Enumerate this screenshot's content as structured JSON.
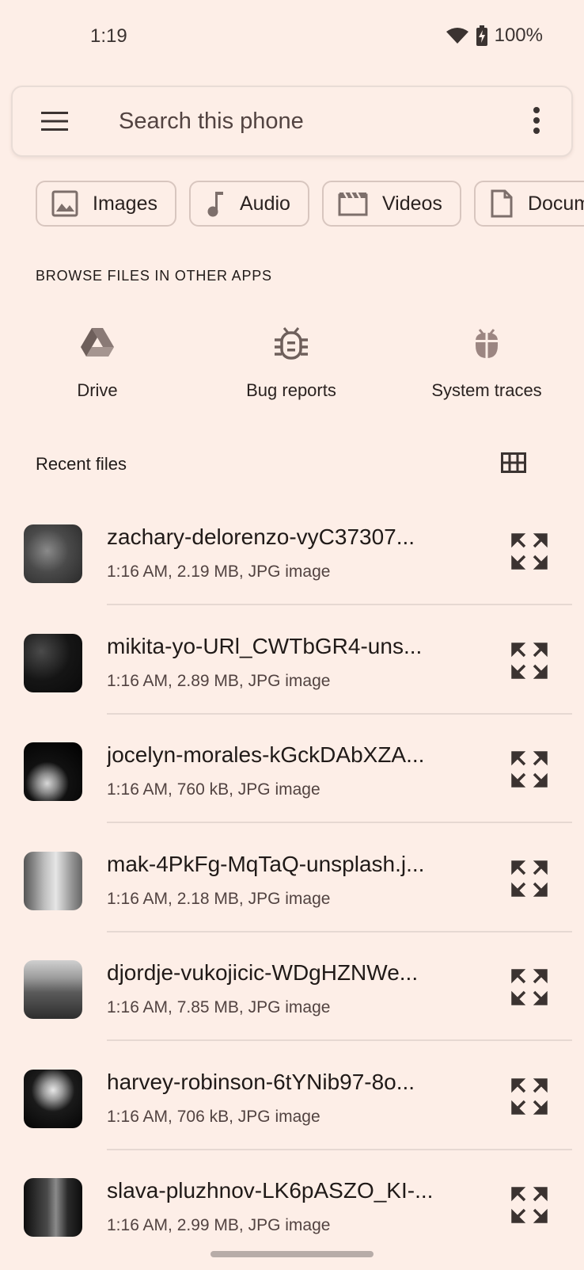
{
  "status_bar": {
    "time": "1:19",
    "battery": "100%",
    "icons": [
      "wifi-icon",
      "battery-charging-icon"
    ]
  },
  "search": {
    "placeholder": "Search this phone",
    "menu_icon": "menu-icon",
    "more_icon": "more-vert-icon"
  },
  "categories": [
    {
      "label": "Images",
      "icon": "image-icon"
    },
    {
      "label": "Audio",
      "icon": "music-note-icon"
    },
    {
      "label": "Videos",
      "icon": "movie-icon"
    },
    {
      "label": "Documents",
      "icon": "document-icon"
    }
  ],
  "browse": {
    "heading": "BROWSE FILES IN OTHER APPS",
    "apps": [
      {
        "label": "Drive",
        "icon": "drive-icon"
      },
      {
        "label": "Bug reports",
        "icon": "bug-report-icon"
      },
      {
        "label": "System traces",
        "icon": "system-traces-icon"
      }
    ]
  },
  "recent": {
    "title": "Recent files",
    "view_icon": "grid-view-icon",
    "files": [
      {
        "name": "zachary-delorenzo-vyC37307...",
        "meta": "1:16 AM, 2.19 MB, JPG image"
      },
      {
        "name": "mikita-yo-URl_CWTbGR4-uns...",
        "meta": "1:16 AM, 2.89 MB, JPG image"
      },
      {
        "name": "jocelyn-morales-kGckDAbXZA...",
        "meta": "1:16 AM, 760 kB, JPG image"
      },
      {
        "name": "mak-4PkFg-MqTaQ-unsplash.j...",
        "meta": "1:16 AM, 2.18 MB, JPG image"
      },
      {
        "name": "djordje-vukojicic-WDgHZNWe...",
        "meta": "1:16 AM, 7.85 MB, JPG image"
      },
      {
        "name": "harvey-robinson-6tYNib97-8o...",
        "meta": "1:16 AM, 706 kB, JPG image"
      },
      {
        "name": "slava-pluzhnov-LK6pASZO_KI-...",
        "meta": "1:16 AM, 2.99 MB, JPG image"
      }
    ]
  },
  "colors": {
    "background": "#FDEEE7",
    "text_primary": "#201A18",
    "text_secondary": "#524341",
    "chip_border": "#D8C6BF",
    "divider": "#E6D8D2"
  }
}
